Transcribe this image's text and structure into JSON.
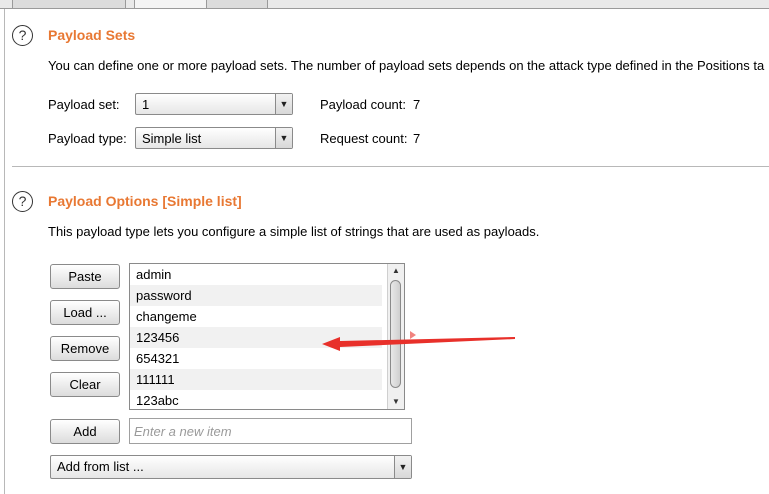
{
  "payload_sets": {
    "help_glyph": "?",
    "title": "Payload Sets",
    "description": "You can define one or more payload sets. The number of payload sets depends on the attack type defined in the Positions ta",
    "payload_set_label": "Payload set:",
    "payload_set_value": "1",
    "payload_count_label": "Payload count:",
    "payload_count_value": "7",
    "payload_type_label": "Payload type:",
    "payload_type_value": "Simple list",
    "request_count_label": "Request count:",
    "request_count_value": "7"
  },
  "payload_options": {
    "help_glyph": "?",
    "title": "Payload Options [Simple list]",
    "description": "This payload type lets you configure a simple list of strings that are used as payloads.",
    "buttons": {
      "paste": "Paste",
      "load": "Load ...",
      "remove": "Remove",
      "clear": "Clear",
      "add": "Add"
    },
    "items": [
      "admin",
      "password",
      "changeme",
      "123456",
      "654321",
      "111111",
      "123abc"
    ],
    "new_item_placeholder": "Enter a new item",
    "add_from_list_value": "Add from list ..."
  },
  "colors": {
    "section_title": "#e87833",
    "annotation_arrow": "#e8302a"
  },
  "icons": {
    "help": "help-icon",
    "dropdown": "chevron-down-icon",
    "scroll_up": "scroll-up-icon",
    "scroll_down": "scroll-down-icon"
  }
}
